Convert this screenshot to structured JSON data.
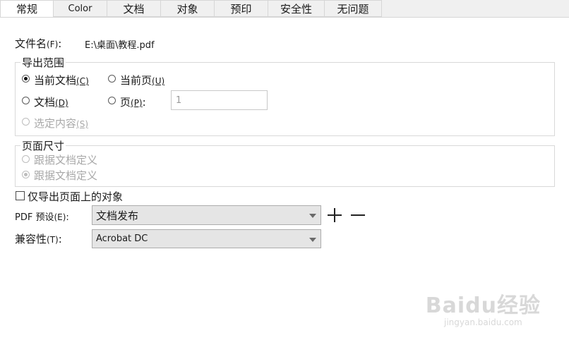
{
  "tabs": [
    {
      "label": "常规",
      "active": true
    },
    {
      "label": "Color",
      "active": false
    },
    {
      "label": "文档",
      "active": false
    },
    {
      "label": "对象",
      "active": false
    },
    {
      "label": "预印",
      "active": false
    },
    {
      "label": "安全性",
      "active": false
    },
    {
      "label": "无问题",
      "active": false
    }
  ],
  "file": {
    "label": "文件名",
    "accel": "(F)",
    "colon": ":",
    "value": "E:\\桌面\\教程.pdf"
  },
  "export_range": {
    "legend": "导出范围",
    "current_doc": {
      "label": "当前文档",
      "accel": "(C)",
      "checked": true
    },
    "current_page": {
      "label": "当前页",
      "accel": "(U)",
      "checked": false
    },
    "document": {
      "label": "文档",
      "accel": "(D)",
      "checked": false
    },
    "page": {
      "label": "页",
      "accel": "(P)",
      "colon": ":",
      "checked": false,
      "value": "1"
    },
    "selection": {
      "label": "选定内容",
      "accel": "(S)",
      "checked": false,
      "disabled": true
    }
  },
  "page_size": {
    "legend": "页面尺寸",
    "option1": {
      "label": "跟据文档定义",
      "checked": false,
      "disabled": true
    },
    "option2": {
      "label": "跟据文档定义",
      "checked": true,
      "disabled": true
    }
  },
  "export_only_on_page": {
    "label": "仅导出页面上的对象",
    "checked": false
  },
  "pdf_preset": {
    "label": "PDF 预设",
    "accel": "(E)",
    "colon": ":",
    "value": "文档发布"
  },
  "compat": {
    "label": "兼容性",
    "accel": "(T)",
    "colon": ":",
    "value": "Acrobat DC"
  },
  "watermark": {
    "logo": "Baidu经验",
    "url": "jingyan.baidu.com"
  }
}
